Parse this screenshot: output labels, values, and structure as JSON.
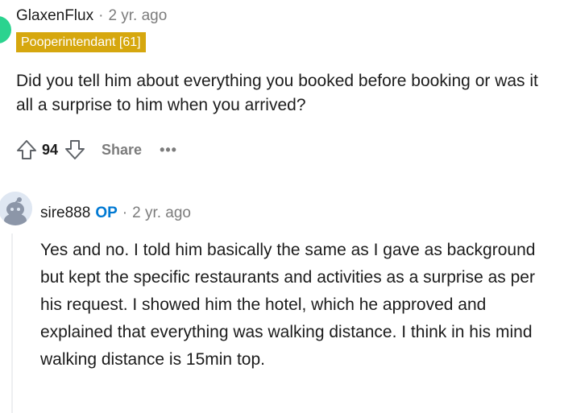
{
  "comment1": {
    "username": "GlaxenFlux",
    "separator": "·",
    "age": "2 yr. ago",
    "flair": "Pooperintendant [61]",
    "body": "Did you tell him about everything you booked before booking or was it all a surprise to him when you arrived?",
    "votes": "94",
    "share_label": "Share",
    "more_label": "•••"
  },
  "comment2": {
    "username": "sire888",
    "op_badge": "OP",
    "separator": "·",
    "age": "2 yr. ago",
    "body": "Yes and no. I told him basically the same as I gave as background but kept the specific restaurants and activities as a surprise as per his request. I showed him the hotel, which he approved and explained that everything was walking distance. I think in his mind walking distance is 15min top."
  },
  "icons": [
    "upvote-icon",
    "downvote-icon",
    "more-icon"
  ],
  "colors": {
    "flair_bg": "#d6a70e",
    "op_blue": "#0079d3",
    "avatar1": "#2bd38f"
  }
}
